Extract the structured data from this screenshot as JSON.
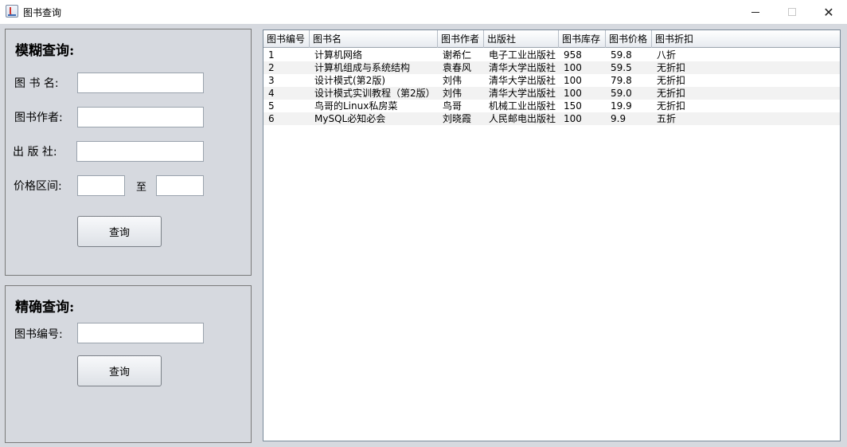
{
  "window": {
    "title": "图书查询",
    "icon": "java-cup-icon"
  },
  "fuzzy": {
    "title": "模糊查询:",
    "name_label": "图 书 名:",
    "author_label": "图书作者:",
    "publisher_label": "出 版 社:",
    "price_label": "价格区间:",
    "to_label": "至",
    "name_value": "",
    "author_value": "",
    "publisher_value": "",
    "price_min_value": "",
    "price_max_value": "",
    "query_label": "查询"
  },
  "exact": {
    "title": "精确查询:",
    "id_label": "图书编号:",
    "id_value": "",
    "query_label": "查询"
  },
  "table": {
    "columns": [
      "图书编号",
      "图书名",
      "图书作者",
      "出版社",
      "图书库存",
      "图书价格",
      "图书折扣"
    ],
    "rows": [
      [
        "1",
        "计算机网络",
        "谢希仁",
        "电子工业出版社",
        "958",
        "59.8",
        "八折"
      ],
      [
        "2",
        "计算机组成与系统结构",
        "袁春风",
        "清华大学出版社",
        "100",
        "59.5",
        "无折扣"
      ],
      [
        "3",
        "设计模式(第2版)",
        "刘伟",
        "清华大学出版社",
        "100",
        "79.8",
        "无折扣"
      ],
      [
        "4",
        "设计模式实训教程（第2版）",
        "刘伟",
        "清华大学出版社",
        "100",
        "59.0",
        "无折扣"
      ],
      [
        "5",
        "鸟哥的Linux私房菜",
        "鸟哥",
        "机械工业出版社",
        "150",
        "19.9",
        "无折扣"
      ],
      [
        "6",
        "MySQL必知必会",
        "刘晓霞",
        "人民邮电出版社",
        "100",
        "9.9",
        "五折"
      ]
    ]
  }
}
